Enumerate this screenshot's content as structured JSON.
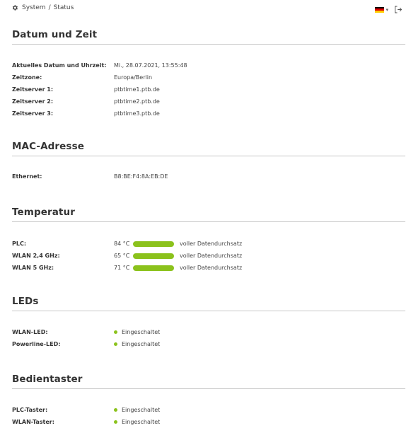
{
  "header": {
    "breadcrumb_root": "System",
    "breadcrumb_separator": "/",
    "breadcrumb_current": "Status",
    "language_flag": "de-flag-icon",
    "logout_icon": "logout-icon"
  },
  "colors": {
    "accent_green": "#8bc21c"
  },
  "datetime": {
    "title": "Datum und Zeit",
    "rows": [
      {
        "label": "Aktuelles Datum und Uhrzeit:",
        "value": "Mi., 28.07.2021, 13:55:48"
      },
      {
        "label": "Zeitzone:",
        "value": "Europa/Berlin"
      },
      {
        "label": "Zeitserver 1:",
        "value": "ptbtime1.ptb.de"
      },
      {
        "label": "Zeitserver 2:",
        "value": "ptbtime2.ptb.de"
      },
      {
        "label": "Zeitserver 3:",
        "value": "ptbtime3.ptb.de"
      }
    ]
  },
  "mac": {
    "title": "MAC-Adresse",
    "rows": [
      {
        "label": "Ethernet:",
        "value": "B8:BE:F4:8A:EB:DE"
      }
    ]
  },
  "temperature": {
    "title": "Temperatur",
    "rows": [
      {
        "label": "PLC:",
        "value": "84 °C",
        "status": "voller Datendurchsatz"
      },
      {
        "label": "WLAN 2,4 GHz:",
        "value": "65 °C",
        "status": "voller Datendurchsatz"
      },
      {
        "label": "WLAN 5 GHz:",
        "value": "71 °C",
        "status": "voller Datendurchsatz"
      }
    ]
  },
  "leds": {
    "title": "LEDs",
    "rows": [
      {
        "label": "WLAN-LED:",
        "value": "Eingeschaltet"
      },
      {
        "label": "Powerline-LED:",
        "value": "Eingeschaltet"
      }
    ]
  },
  "buttons": {
    "title": "Bedientaster",
    "rows": [
      {
        "label": "PLC-Taster:",
        "value": "Eingeschaltet"
      },
      {
        "label": "WLAN-Taster:",
        "value": "Eingeschaltet"
      }
    ]
  }
}
